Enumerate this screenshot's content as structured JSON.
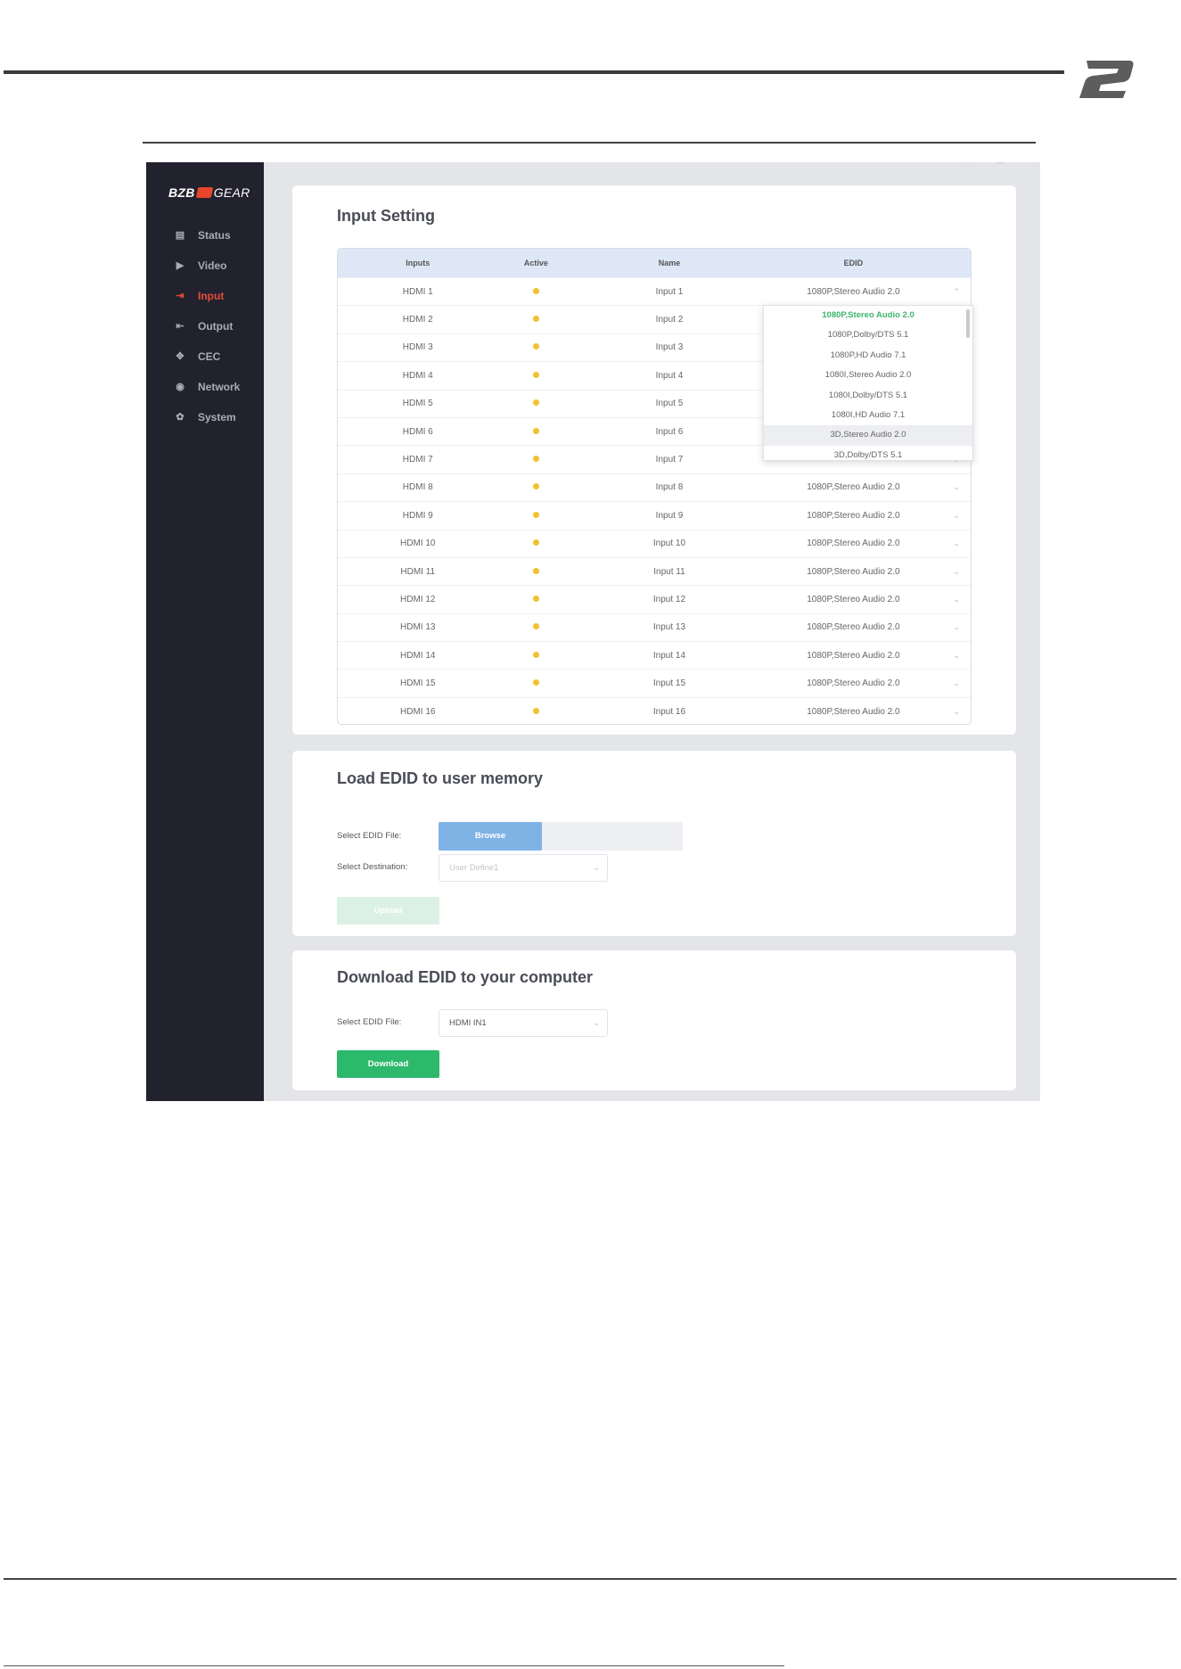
{
  "brand": {
    "left": "BZB",
    "right": "GEAR"
  },
  "sidebar": {
    "items": [
      {
        "label": "Status",
        "icon": "document-icon",
        "active": false
      },
      {
        "label": "Video",
        "icon": "play-icon",
        "active": false
      },
      {
        "label": "Input",
        "icon": "input-arrow-icon",
        "active": true
      },
      {
        "label": "Output",
        "icon": "output-arrow-icon",
        "active": false
      },
      {
        "label": "CEC",
        "icon": "cec-icon",
        "active": false
      },
      {
        "label": "Network",
        "icon": "network-icon",
        "active": false
      },
      {
        "label": "System",
        "icon": "gear-icon",
        "active": false
      }
    ]
  },
  "input_setting": {
    "title": "Input Setting",
    "columns": [
      "Inputs",
      "Active",
      "Name",
      "EDID"
    ],
    "rows": [
      {
        "input": "HDMI 1",
        "name": "Input 1",
        "edid": "1080P,Stereo Audio 2.0"
      },
      {
        "input": "HDMI 2",
        "name": "Input 2",
        "edid": ""
      },
      {
        "input": "HDMI 3",
        "name": "Input 3",
        "edid": ""
      },
      {
        "input": "HDMI 4",
        "name": "Input 4",
        "edid": ""
      },
      {
        "input": "HDMI 5",
        "name": "Input 5",
        "edid": ""
      },
      {
        "input": "HDMI 6",
        "name": "Input 6",
        "edid": ""
      },
      {
        "input": "HDMI 7",
        "name": "Input 7",
        "edid": ""
      },
      {
        "input": "HDMI 8",
        "name": "Input 8",
        "edid": "1080P,Stereo Audio 2.0"
      },
      {
        "input": "HDMI 9",
        "name": "Input 9",
        "edid": "1080P,Stereo Audio 2.0"
      },
      {
        "input": "HDMI 10",
        "name": "Input 10",
        "edid": "1080P,Stereo Audio 2.0"
      },
      {
        "input": "HDMI 11",
        "name": "Input 11",
        "edid": "1080P,Stereo Audio 2.0"
      },
      {
        "input": "HDMI 12",
        "name": "Input 12",
        "edid": "1080P,Stereo Audio 2.0"
      },
      {
        "input": "HDMI 13",
        "name": "Input 13",
        "edid": "1080P,Stereo Audio 2.0"
      },
      {
        "input": "HDMI 14",
        "name": "Input 14",
        "edid": "1080P,Stereo Audio 2.0"
      },
      {
        "input": "HDMI 15",
        "name": "Input 15",
        "edid": "1080P,Stereo Audio 2.0"
      },
      {
        "input": "HDMI 16",
        "name": "Input 16",
        "edid": "1080P,Stereo Audio 2.0"
      }
    ],
    "edid_options": [
      "1080P,Stereo Audio 2.0",
      "1080P,Dolby/DTS 5.1",
      "1080P,HD Audio 7.1",
      "1080I,Stereo Audio 2.0",
      "1080I,Dolby/DTS 5.1",
      "1080I,HD Audio 7.1",
      "3D,Stereo Audio 2.0",
      "3D,Dolby/DTS 5.1"
    ],
    "edid_selected_index": 0,
    "edid_hover_index": 6
  },
  "load_edid": {
    "title": "Load EDID to user memory",
    "file_label": "Select EDID File:",
    "browse_label": "Browse",
    "dest_label": "Select Destination:",
    "dest_value": "User Define1",
    "upload_label": "Upload"
  },
  "download_edid": {
    "title": "Download EDID to your computer",
    "file_label": "Select EDID File:",
    "file_value": "HDMI IN1",
    "download_label": "Download"
  },
  "colors": {
    "sidebar_bg": "#22222e",
    "active_nav": "#e94b3a",
    "active_dot": "#f2c12e",
    "download_green": "#2db96b",
    "browse_blue": "#7fb3e6",
    "selected_option": "#3cb56e"
  }
}
